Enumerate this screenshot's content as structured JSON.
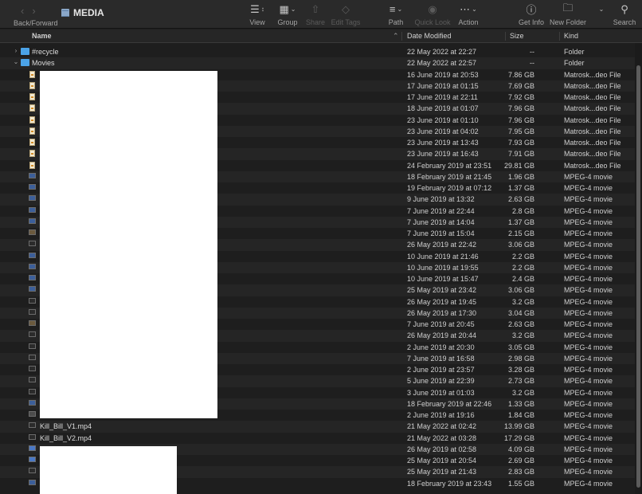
{
  "window": {
    "title": "MEDIA",
    "back_forward_label": "Back/Forward"
  },
  "toolbar": {
    "view_label": "View",
    "group_label": "Group",
    "share_label": "Share",
    "edit_tags_label": "Edit Tags",
    "path_label": "Path",
    "quick_look_label": "Quick Look",
    "action_label": "Action",
    "get_info_label": "Get Info",
    "new_folder_label": "New Folder",
    "search_label": "Search"
  },
  "columns": {
    "name": "Name",
    "date_modified": "Date Modified",
    "size": "Size",
    "kind": "Kind"
  },
  "rows": [
    {
      "name": "#recycle",
      "date": "22 May 2022 at 22:27",
      "size": "--",
      "kind": "Folder",
      "icon": "folder-icon",
      "disclosure": "collapsed"
    },
    {
      "name": "Movies",
      "date": "22 May 2022 at 22:57",
      "size": "--",
      "kind": "Folder",
      "icon": "folder-icon",
      "disclosure": "expanded"
    },
    {
      "name": "",
      "date": "16 June 2019 at 20:53",
      "size": "7.86 GB",
      "kind": "Matrosk...deo File",
      "icon": "mkv-file-icon"
    },
    {
      "name": "",
      "date": "17 June 2019 at 01:15",
      "size": "7.69 GB",
      "kind": "Matrosk...deo File",
      "icon": "mkv-file-icon"
    },
    {
      "name": "",
      "date": "17 June 2019 at 22:11",
      "size": "7.92 GB",
      "kind": "Matrosk...deo File",
      "icon": "mkv-file-icon"
    },
    {
      "name": "",
      "date": "18 June 2019 at 01:07",
      "size": "7.96 GB",
      "kind": "Matrosk...deo File",
      "icon": "mkv-file-icon"
    },
    {
      "name": "",
      "date": "23 June 2019 at 01:10",
      "size": "7.96 GB",
      "kind": "Matrosk...deo File",
      "icon": "mkv-file-icon"
    },
    {
      "name": "",
      "date": "23 June 2019 at 04:02",
      "size": "7.95 GB",
      "kind": "Matrosk...deo File",
      "icon": "mkv-file-icon"
    },
    {
      "name": "",
      "date": "23 June 2019 at 13:43",
      "size": "7.93 GB",
      "kind": "Matrosk...deo File",
      "icon": "mkv-file-icon"
    },
    {
      "name": "",
      "date": "23 June 2019 at 16:43",
      "size": "7.91 GB",
      "kind": "Matrosk...deo File",
      "icon": "mkv-file-icon"
    },
    {
      "name": "",
      "date": "24 February 2019 at 23:51",
      "size": "29.81 GB",
      "kind": "Matrosk...deo File",
      "icon": "mkv-file-icon"
    },
    {
      "name": "",
      "date": "18 February 2019 at 21:45",
      "size": "1.96 GB",
      "kind": "MPEG-4 movie",
      "icon": "mp4-thumbnail-icon",
      "tone": "blue"
    },
    {
      "name": "",
      "date": "19 February 2019 at 07:12",
      "size": "1.37 GB",
      "kind": "MPEG-4 movie",
      "icon": "mp4-thumbnail-icon",
      "tone": "blue"
    },
    {
      "name": "",
      "date": "9 June 2019 at 13:32",
      "size": "2.63 GB",
      "kind": "MPEG-4 movie",
      "icon": "mp4-thumbnail-icon",
      "tone": "blue"
    },
    {
      "name": "",
      "date": "7 June 2019 at 22:44",
      "size": "2.8 GB",
      "kind": "MPEG-4 movie",
      "icon": "mp4-thumbnail-icon",
      "tone": "blue"
    },
    {
      "name": "",
      "date": "7 June 2019 at 14:04",
      "size": "1.37 GB",
      "kind": "MPEG-4 movie",
      "icon": "mp4-thumbnail-icon",
      "tone": "blue"
    },
    {
      "name": "",
      "date": "7 June 2019 at 15:04",
      "size": "2.15 GB",
      "kind": "MPEG-4 movie",
      "icon": "mp4-thumbnail-icon",
      "tone": "warm"
    },
    {
      "name": "",
      "date": "26 May 2019 at 22:42",
      "size": "3.06 GB",
      "kind": "MPEG-4 movie",
      "icon": "mp4-thumbnail-icon",
      "tone": "dark"
    },
    {
      "name": "",
      "date": "10 June 2019 at 21:46",
      "size": "2.2 GB",
      "kind": "MPEG-4 movie",
      "icon": "mp4-thumbnail-icon",
      "tone": "blue"
    },
    {
      "name": "",
      "date": "10 June 2019 at 19:55",
      "size": "2.2 GB",
      "kind": "MPEG-4 movie",
      "icon": "mp4-thumbnail-icon",
      "tone": "blue"
    },
    {
      "name": "",
      "date": "10 June 2019 at 15:47",
      "size": "2.4 GB",
      "kind": "MPEG-4 movie",
      "icon": "mp4-thumbnail-icon",
      "tone": "blue"
    },
    {
      "name": "",
      "date": "25 May 2019 at 23:42",
      "size": "3.06 GB",
      "kind": "MPEG-4 movie",
      "icon": "mp4-thumbnail-icon",
      "tone": "blue"
    },
    {
      "name": "",
      "date": "26 May 2019 at 19:45",
      "size": "3.2 GB",
      "kind": "MPEG-4 movie",
      "icon": "mp4-thumbnail-icon",
      "tone": "dark"
    },
    {
      "name": "",
      "date": "26 May 2019 at 17:30",
      "size": "3.04 GB",
      "kind": "MPEG-4 movie",
      "icon": "mp4-thumbnail-icon",
      "tone": "dark"
    },
    {
      "name": "",
      "date": "7 June 2019 at 20:45",
      "size": "2.63 GB",
      "kind": "MPEG-4 movie",
      "icon": "mp4-thumbnail-icon",
      "tone": "warm"
    },
    {
      "name": "",
      "date": "26 May 2019 at 20:44",
      "size": "3.2 GB",
      "kind": "MPEG-4 movie",
      "icon": "mp4-thumbnail-icon",
      "tone": "dark"
    },
    {
      "name": "",
      "date": "2 June 2019 at 20:30",
      "size": "3.05 GB",
      "kind": "MPEG-4 movie",
      "icon": "mp4-thumbnail-icon",
      "tone": "dark"
    },
    {
      "name": "",
      "date": "7 June 2019 at 16:58",
      "size": "2.98 GB",
      "kind": "MPEG-4 movie",
      "icon": "mp4-thumbnail-icon",
      "tone": "dark"
    },
    {
      "name": "",
      "date": "2 June 2019 at 23:57",
      "size": "3.28 GB",
      "kind": "MPEG-4 movie",
      "icon": "mp4-thumbnail-icon",
      "tone": "dark"
    },
    {
      "name": "",
      "date": "5 June 2019 at 22:39",
      "size": "2.73 GB",
      "kind": "MPEG-4 movie",
      "icon": "mp4-thumbnail-icon",
      "tone": "dark"
    },
    {
      "name": "",
      "date": "3 June 2019 at 01:03",
      "size": "3.2 GB",
      "kind": "MPEG-4 movie",
      "icon": "mp4-thumbnail-icon",
      "tone": "dark"
    },
    {
      "name": "",
      "date": "18 February 2019 at 22:46",
      "size": "1.33 GB",
      "kind": "MPEG-4 movie",
      "icon": "mp4-thumbnail-icon",
      "tone": "blue"
    },
    {
      "name": "",
      "date": "2 June 2019 at 19:16",
      "size": "1.84 GB",
      "kind": "MPEG-4 movie",
      "icon": "mp4-thumbnail-icon",
      "tone": "grey"
    },
    {
      "name": "Kill_Bill_V1.mp4",
      "date": "21 May 2022 at 02:42",
      "size": "13.99 GB",
      "kind": "MPEG-4 movie",
      "icon": "mp4-thumbnail-icon",
      "tone": "dark"
    },
    {
      "name": "Kill_Bill_V2.mp4",
      "date": "21 May 2022 at 03:28",
      "size": "17.29 GB",
      "kind": "MPEG-4 movie",
      "icon": "mp4-thumbnail-icon",
      "tone": "dark"
    },
    {
      "name": "",
      "date": "26 May 2019 at 02:58",
      "size": "4.09 GB",
      "kind": "MPEG-4 movie",
      "icon": "mp4-thumbnail-icon",
      "tone": "bright"
    },
    {
      "name": "",
      "date": "25 May 2019 at 20:54",
      "size": "2.69 GB",
      "kind": "MPEG-4 movie",
      "icon": "mp4-thumbnail-icon",
      "tone": "bright"
    },
    {
      "name": "",
      "date": "25 May 2019 at 21:43",
      "size": "2.83 GB",
      "kind": "MPEG-4 movie",
      "icon": "mp4-thumbnail-icon",
      "tone": "dark"
    },
    {
      "name": "",
      "date": "18 February 2019 at 23:43",
      "size": "1.55 GB",
      "kind": "MPEG-4 movie",
      "icon": "mp4-thumbnail-icon",
      "tone": "blue"
    }
  ]
}
